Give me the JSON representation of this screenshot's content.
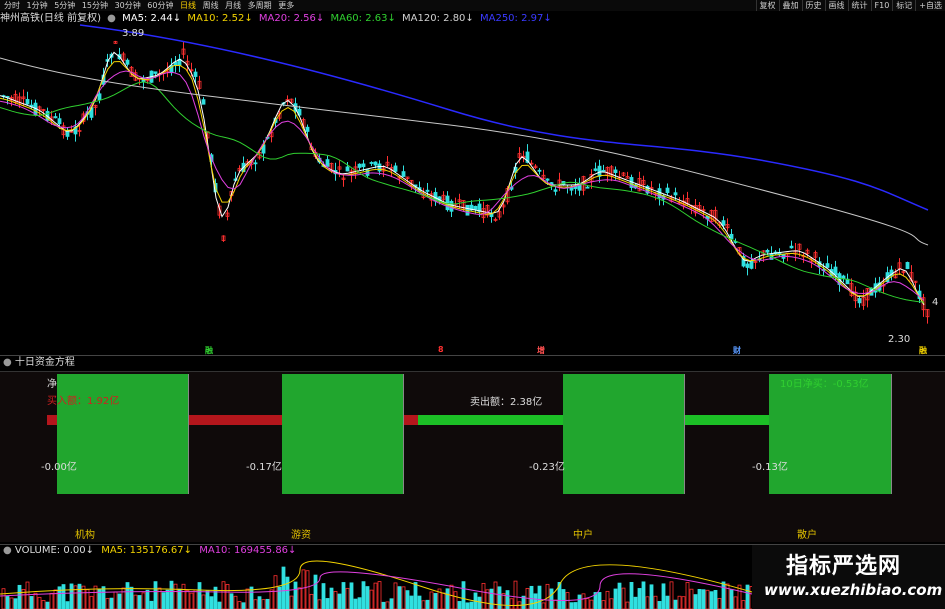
{
  "toolbar": {
    "timeframes": [
      "分时",
      "1分钟",
      "5分钟",
      "15分钟",
      "30分钟",
      "60分钟",
      "日线",
      "周线",
      "月线",
      "多周期",
      "更多"
    ],
    "active": "日线",
    "right_buttons": [
      "复权",
      "叠加",
      "历史",
      "画线",
      "统计",
      "F10",
      "标记",
      "+自选"
    ]
  },
  "main_chart": {
    "title": "神州高铁(日线 前复权)",
    "ma": [
      {
        "label": "MA5: 2.44↓",
        "color": "#ffffff"
      },
      {
        "label": "MA10: 2.52↓",
        "color": "#f2d200"
      },
      {
        "label": "MA20: 2.56↓",
        "color": "#e040e0"
      },
      {
        "label": "MA60: 2.63↓",
        "color": "#30d030"
      },
      {
        "label": "MA120: 2.80↓",
        "color": "#d0d0d0"
      },
      {
        "label": "MA250: 2.97↓",
        "color": "#3a3aff"
      }
    ],
    "high_label": "3.89",
    "low_label": "2.30",
    "right_edge_label": "4",
    "event_tags": [
      {
        "text": "融",
        "color": "#30d030"
      },
      {
        "text": "8",
        "color": "#ff3030"
      },
      {
        "text": "增",
        "color": "#ff5050"
      },
      {
        "text": "财",
        "color": "#5a9aff"
      },
      {
        "text": "融",
        "color": "#f2d200"
      }
    ]
  },
  "fund_panel": {
    "title": "十日资金方程",
    "labels": {
      "net": "净",
      "buy": "买入额：1.92亿",
      "sell": "卖出额：2.38亿",
      "net10": "10日净买：-0.53亿"
    },
    "values": [
      "-0.00亿",
      "-0.17亿",
      "-0.23亿",
      "-0.13亿"
    ],
    "groups": [
      "机构",
      "游资",
      "中户",
      "散户"
    ]
  },
  "volume": {
    "title": "VOLUME: 0.00↓",
    "ma5": "MA5: 135176.67↓",
    "ma10": "MA10: 169455.86↓"
  },
  "watermark": {
    "name": "指标严选网",
    "url": "www.xuezhibiao.com"
  },
  "colors": {
    "up": "#ff3030",
    "down": "#30e0e0",
    "fund_green": "#21a62e",
    "fund_red": "#b4161c"
  }
}
